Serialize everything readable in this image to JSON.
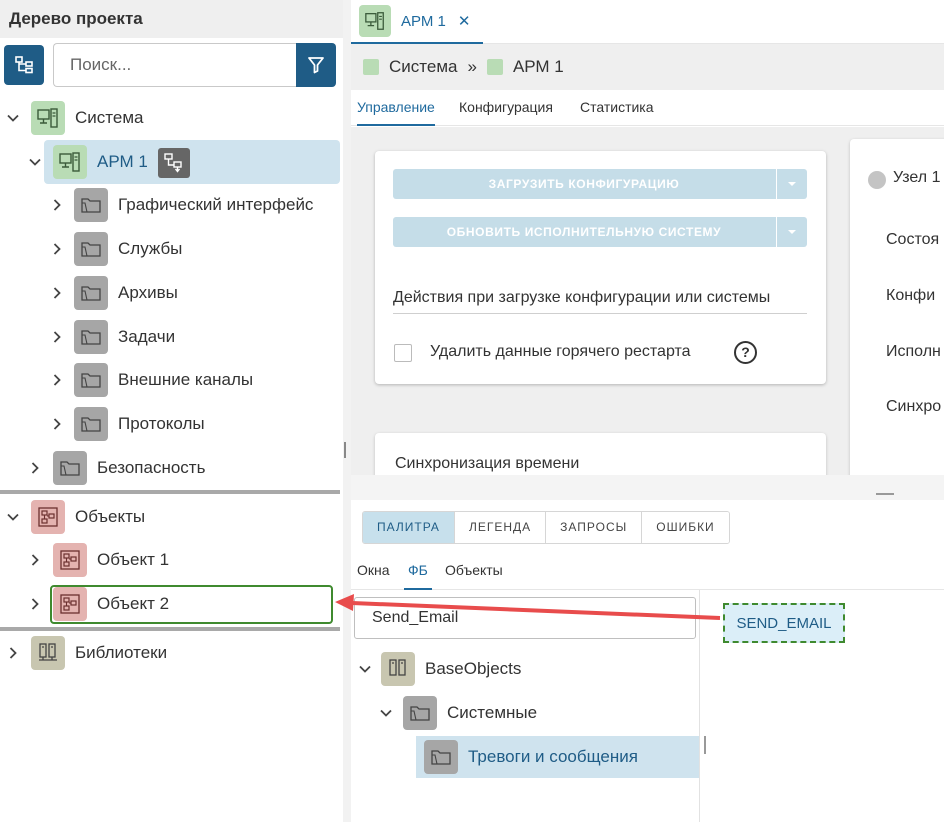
{
  "left_panel": {
    "title": "Дерево проекта",
    "search_placeholder": "Поиск...",
    "tree": {
      "sistema": "Система",
      "arm1": "АРМ 1",
      "children": [
        "Графический интерфейс",
        "Службы",
        "Архивы",
        "Задачи",
        "Внешние каналы",
        "Протоколы"
      ],
      "security": "Безопасность",
      "objects": "Объекты",
      "object1": "Объект 1",
      "object2": "Объект 2",
      "libraries": "Библиотеки"
    }
  },
  "tabs": {
    "tab1_label": "АРМ 1",
    "tab1_close": "✕"
  },
  "breadcrumb": {
    "item1": "Система",
    "separator": "»",
    "item2": "АРМ 1"
  },
  "subtabs": [
    "Управление",
    "Конфигурация",
    "Статистика"
  ],
  "management": {
    "load_config_button": "ЗАГРУЗИТЬ КОНФИГУРАЦИЮ",
    "update_system_button": "ОБНОВИТЬ ИСПОЛНИТЕЛЬНУЮ СИСТЕМУ",
    "actions_label": "Действия при загрузке конфигурации или системы",
    "delete_hot_restart_label": "Удалить данные горячего рестарта",
    "help_symbol": "?",
    "time_sync_title": "Синхронизация времени"
  },
  "node_panel": {
    "node_label": "Узел 1",
    "rows": [
      "Состоя",
      "Конфи",
      "Исполн",
      "Синхро"
    ]
  },
  "palette": {
    "segments": [
      "ПАЛИТРА",
      "ЛЕГЕНДА",
      "ЗАПРОСЫ",
      "ОШИБКИ"
    ],
    "tabs": [
      "Окна",
      "ФБ",
      "Объекты"
    ],
    "search_value": "Send_Email",
    "tree": {
      "root": "BaseObjects",
      "child": "Системные",
      "leaf": "Тревоги и сообщения"
    }
  },
  "dragged_block": {
    "label": "SEND_EMAIL"
  },
  "colors": {
    "accent": "#1f5c86",
    "selection": "#cfe3ee",
    "drop_target": "#3f8a2f",
    "arrow": "#e84c4c"
  }
}
